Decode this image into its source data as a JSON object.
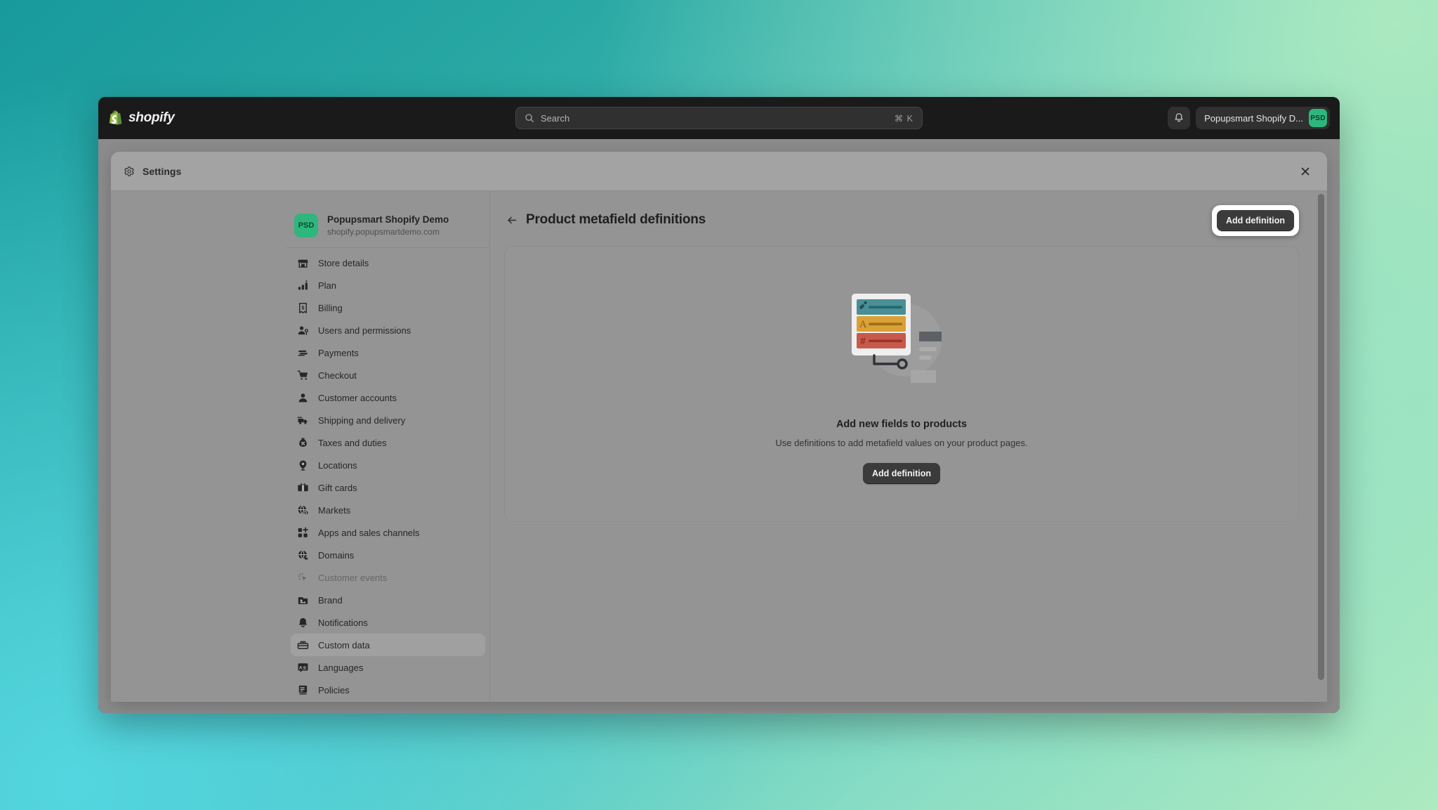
{
  "topbar": {
    "logo_word": "shopify",
    "logo_icon": "shopify-bag-icon",
    "search": {
      "placeholder": "Search",
      "shortcut": "⌘ K",
      "icon": "search-icon"
    },
    "notifications_icon": "bell-icon",
    "account": {
      "name": "Popupsmart Shopify D...",
      "avatar_initials": "PSD",
      "avatar_color": "#2eb67d"
    }
  },
  "modal": {
    "title": "Settings",
    "title_icon": "gear-icon",
    "close_icon": "close-icon"
  },
  "sidebar": {
    "store": {
      "avatar_initials": "PSD",
      "name": "Popupsmart Shopify Demo",
      "domain": "shopify.popupsmartdemo.com"
    },
    "items": [
      {
        "label": "Store details",
        "icon": "store-icon",
        "state": "normal"
      },
      {
        "label": "Plan",
        "icon": "plan-chart-icon",
        "state": "normal"
      },
      {
        "label": "Billing",
        "icon": "billing-icon",
        "state": "normal"
      },
      {
        "label": "Users and permissions",
        "icon": "users-icon",
        "state": "normal"
      },
      {
        "label": "Payments",
        "icon": "payments-icon",
        "state": "normal"
      },
      {
        "label": "Checkout",
        "icon": "cart-icon",
        "state": "normal"
      },
      {
        "label": "Customer accounts",
        "icon": "person-icon",
        "state": "normal"
      },
      {
        "label": "Shipping and delivery",
        "icon": "truck-icon",
        "state": "normal"
      },
      {
        "label": "Taxes and duties",
        "icon": "taxes-icon",
        "state": "normal"
      },
      {
        "label": "Locations",
        "icon": "location-pin-icon",
        "state": "normal"
      },
      {
        "label": "Gift cards",
        "icon": "gift-card-icon",
        "state": "normal"
      },
      {
        "label": "Markets",
        "icon": "globe-dollar-icon",
        "state": "normal"
      },
      {
        "label": "Apps and sales channels",
        "icon": "apps-grid-icon",
        "state": "normal"
      },
      {
        "label": "Domains",
        "icon": "domain-globe-icon",
        "state": "normal"
      },
      {
        "label": "Customer events",
        "icon": "cursor-spark-icon",
        "state": "disabled"
      },
      {
        "label": "Brand",
        "icon": "brand-image-icon",
        "state": "normal"
      },
      {
        "label": "Notifications",
        "icon": "bell-icon",
        "state": "normal"
      },
      {
        "label": "Custom data",
        "icon": "custom-data-icon",
        "state": "selected"
      },
      {
        "label": "Languages",
        "icon": "languages-icon",
        "state": "normal"
      },
      {
        "label": "Policies",
        "icon": "policies-icon",
        "state": "normal"
      }
    ]
  },
  "main": {
    "back_icon": "arrow-left-icon",
    "page_title": "Product metafield definitions",
    "primary_action_label": "Add definition",
    "empty_state": {
      "illustration": "metafield-definitions-illustration",
      "title": "Add new fields to products",
      "subtitle": "Use definitions to add metafield values on your product pages.",
      "action_label": "Add definition",
      "illustration_colors": {
        "row1": "#4a8f96",
        "row2": "#d9a136",
        "row3": "#c75a4c"
      }
    }
  },
  "colors": {
    "accent_green": "#2eb67d",
    "topbar_bg": "#1a1a1a",
    "modal_bg": "#949494",
    "button_dark": "#3b3b3b",
    "highlight_ring": "#ffffff"
  }
}
